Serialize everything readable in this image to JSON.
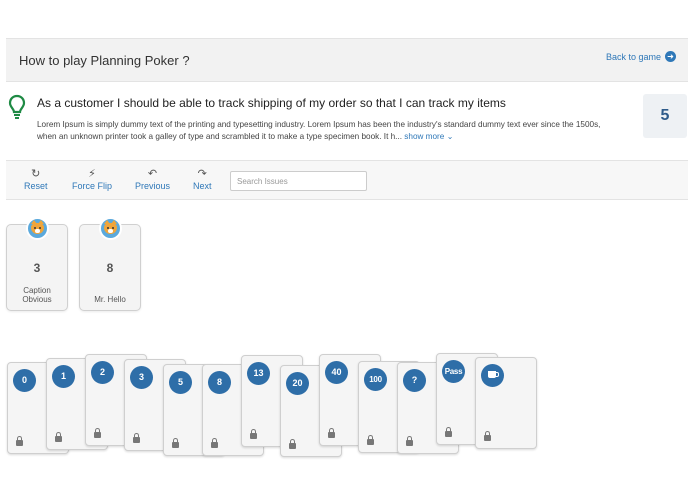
{
  "header": {
    "title": "How to play Planning Poker ?",
    "back_label": "Back to game"
  },
  "story": {
    "title": "As a customer I should be able to track shipping of my order so that I can track my items",
    "description": "Lorem Ipsum is simply dummy text of the printing and typesetting industry. Lorem Ipsum has been the industry's standard dummy text ever since the 1500s, when an unknown printer took a galley of type and scrambled it to make a type specimen book. It h...",
    "show_more": "show more",
    "points": "5"
  },
  "toolbar": {
    "reset": "Reset",
    "force_flip": "Force Flip",
    "previous": "Previous",
    "next": "Next",
    "search_placeholder": "Search Issues"
  },
  "players": [
    {
      "vote": "3",
      "name": "Caption Obvious"
    },
    {
      "vote": "8",
      "name": "Mr. Hello"
    }
  ],
  "deck": [
    "0",
    "1",
    "2",
    "3",
    "5",
    "8",
    "13",
    "20",
    "40",
    "100",
    "?",
    "Pass",
    "coffee"
  ],
  "colors": {
    "accent": "#2f78b8",
    "card_circle": "#2e6ea8",
    "bulb": "#1e8a44"
  }
}
